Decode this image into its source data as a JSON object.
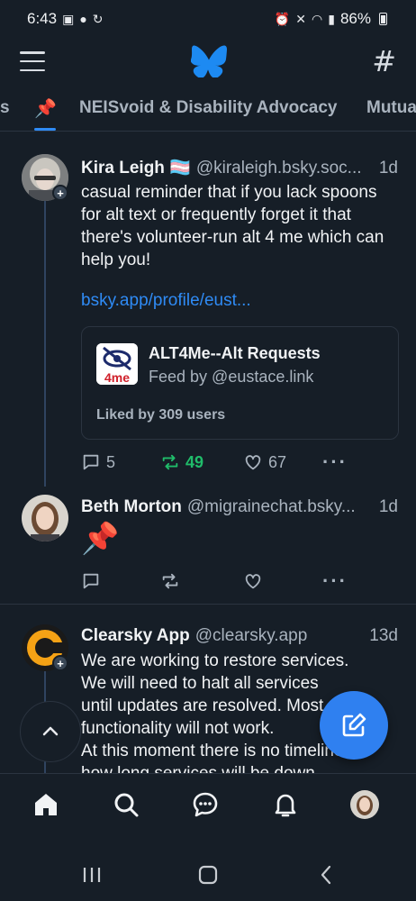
{
  "status_bar": {
    "time": "6:43",
    "left_icons": [
      "calendar-icon",
      "person-add-icon",
      "sync-icon"
    ],
    "right_icons": [
      "alarm-icon",
      "mute-icon",
      "wifi-icon",
      "signal-icon"
    ],
    "battery": "86%"
  },
  "header": {
    "logo": "butterfly-logo",
    "menu_icon": "menu-icon",
    "feeds_icon": "hash-icon"
  },
  "tabs": [
    {
      "label": "s"
    },
    {
      "label": "📌",
      "active": true
    },
    {
      "label": "NEISvoid & Disability Advocacy"
    },
    {
      "label": "Mutua"
    }
  ],
  "posts": [
    {
      "name": "Kira Leigh 🏳️‍⚧️",
      "handle": "@kiraleigh.bsky.soc...",
      "time": "1d",
      "text": "casual reminder that if you lack spoons for alt text or frequently forget it that there's volunteer-run alt 4 me which can help you!",
      "link": "bsky.app/profile/eust...",
      "embed": {
        "title": "ALT4Me--Alt Requests",
        "subtitle": "Feed by @eustace.link",
        "likes": "Liked by 309 users",
        "icon_text": "4me"
      },
      "replies": "5",
      "reposts": "49",
      "likes": "67",
      "repost_color": "#20bc6a"
    },
    {
      "name": "Beth Morton",
      "handle": "@migrainechat.bsky...",
      "time": "1d",
      "text": "📌",
      "replies": "",
      "reposts": "",
      "likes": ""
    },
    {
      "name": "Clearsky App",
      "handle": "@clearsky.app",
      "time": "13d",
      "text": "We are working to restore services.\nWe will need to halt all services\nuntil updates are resolved. Most\nfunctionality will not work.\nAt this moment there is no timeline for\nhow long services will be down"
    }
  ],
  "bottom_nav": [
    "home-icon",
    "search-icon",
    "chat-icon",
    "bell-icon",
    "profile-avatar"
  ],
  "system_nav": [
    "recents-button",
    "home-button",
    "back-button"
  ],
  "colors": {
    "accent": "#2f8bf5",
    "background": "#161e27",
    "repost_active": "#20bc6a"
  }
}
